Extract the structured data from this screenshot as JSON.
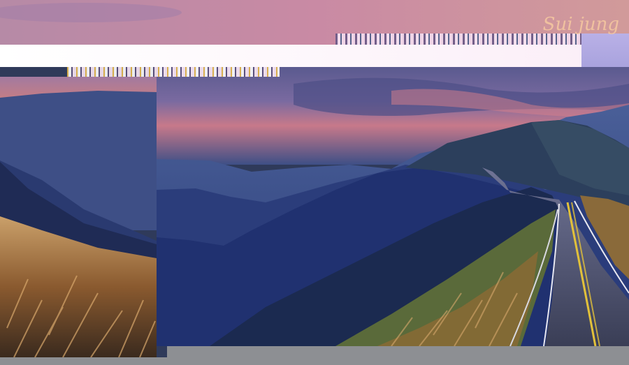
{
  "image": {
    "signature_text": "Sui jung",
    "colors": {
      "sky_top": "#c48aa6",
      "sky_mid": "#a58cc4",
      "sky_glow": "#e98a88",
      "mountain_far": "#3d4f86",
      "mountain_mid": "#263a78",
      "mountain_near": "#1d2f5e",
      "grass_warm": "#b87a35",
      "road": "#3b3f58",
      "road_line": "#e2c13a"
    }
  }
}
